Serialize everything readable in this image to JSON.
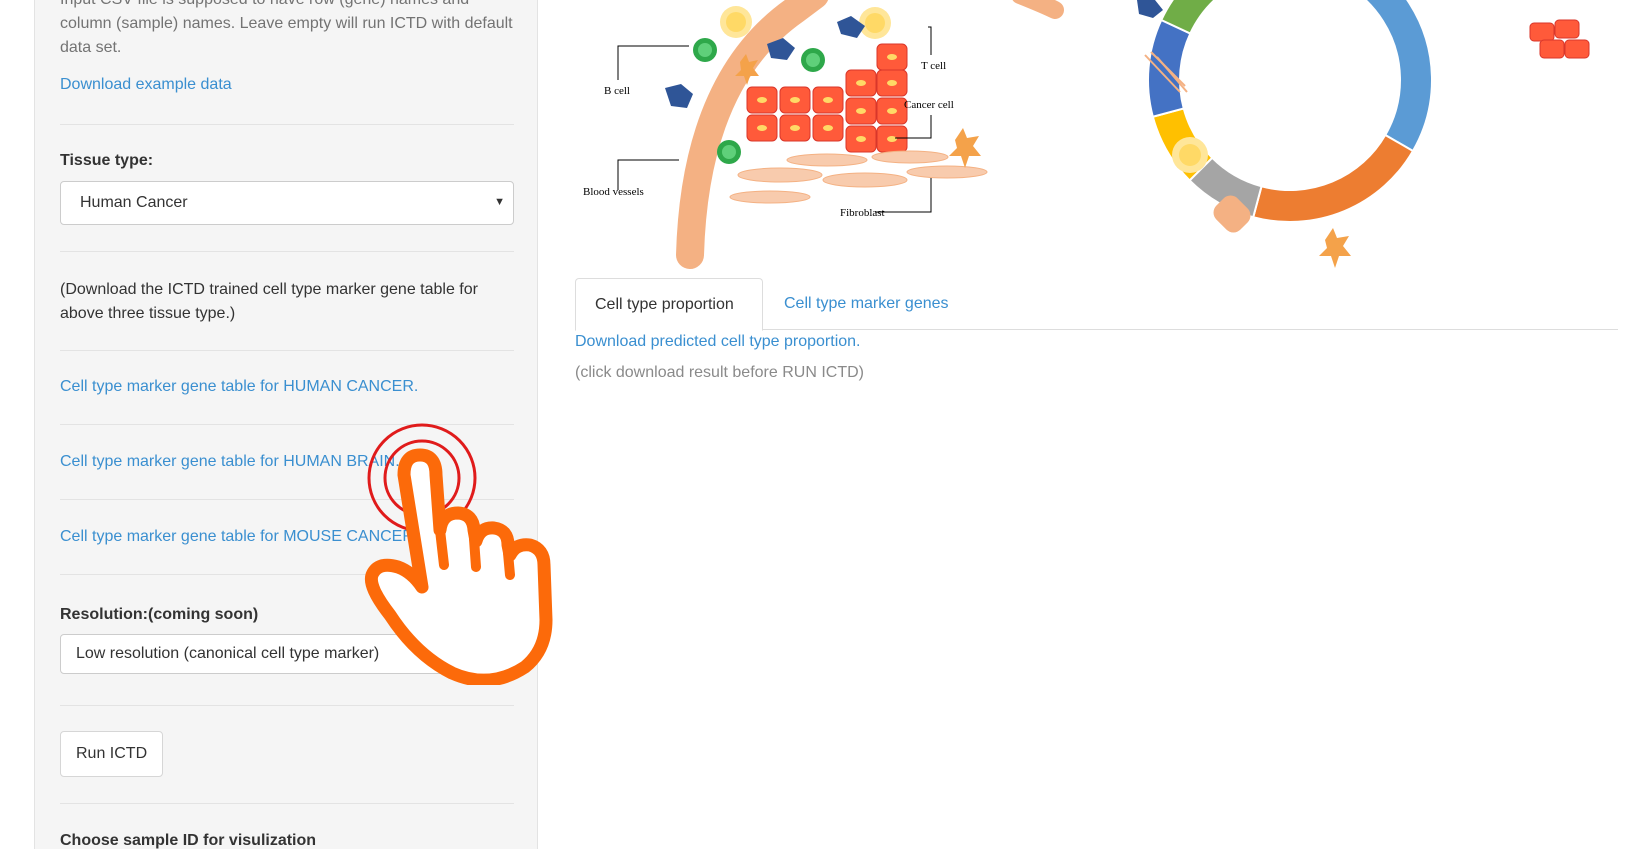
{
  "sidebar": {
    "upload_help": "Input CSV file is supposed to have row (gene) names and column (sample) names. Leave empty will run ICTD with default data set.",
    "download_example": "Download example data",
    "tissue_label": "Tissue type:",
    "tissue_value": "Human Cancer",
    "tissue_help": "(Download the ICTD trained cell type marker gene table for above three tissue type.)",
    "marker_links": [
      "Cell type marker gene table for HUMAN CANCER.",
      "Cell type marker gene table for HUMAN BRAIN.",
      "Cell type marker gene table for MOUSE CANCER."
    ],
    "resolution_label": "Resolution:(coming soon)",
    "resolution_value": "Low resolution (canonical cell type marker)",
    "run_button": "Run ICTD",
    "sample_label": "Choose sample ID for visulization"
  },
  "illustration": {
    "labels": {
      "b_cell": "B cell",
      "t_cell": "T cell",
      "cancer_cell": "Cancer cell",
      "blood_vessels": "Blood vessels",
      "fibroblast": "Fibroblast"
    },
    "donut_colors": [
      "#5b9bd5",
      "#ed7d31",
      "#a5a5a5",
      "#ffc000",
      "#4472c4",
      "#70ad47"
    ]
  },
  "main": {
    "tabs": [
      "Cell type proportion",
      "Cell type marker genes"
    ],
    "active_tab": "Cell type proportion",
    "download_link": "Download predicted cell type proportion.",
    "download_note": "(click download result before RUN ICTD)"
  },
  "colors": {
    "link": "#3a8fd0",
    "hand": "#fc6a0a",
    "click_ring": "#e01b1b"
  }
}
